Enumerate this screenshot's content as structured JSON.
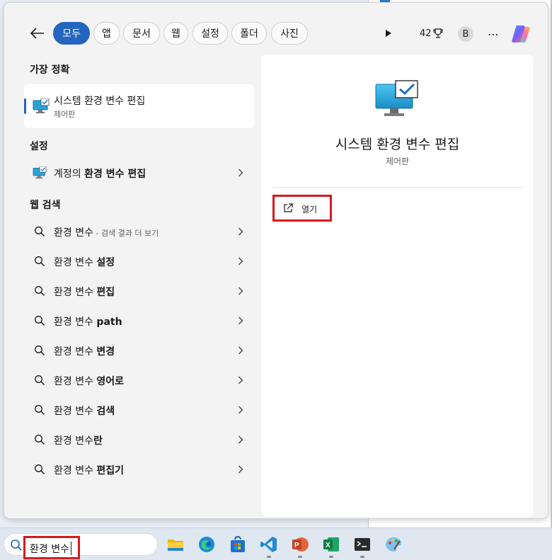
{
  "filters": {
    "back_label": "",
    "chips": [
      {
        "label": "모두",
        "active": true
      },
      {
        "label": "앱",
        "active": false
      },
      {
        "label": "문서",
        "active": false
      },
      {
        "label": "웹",
        "active": false
      },
      {
        "label": "설정",
        "active": false
      },
      {
        "label": "폴더",
        "active": false
      },
      {
        "label": "사진",
        "active": false
      }
    ],
    "points": "42",
    "avatar_letter": "B"
  },
  "best_match": {
    "heading": "가장 정확",
    "title": "시스템 환경 변수 편집",
    "subtitle": "제어판"
  },
  "settings": {
    "heading": "설정",
    "item_prefix": "계정의 ",
    "item_bold": "환경 변수 편집"
  },
  "web": {
    "heading": "웹 검색",
    "items": [
      {
        "plain": "환경 변수",
        "bold": "",
        "sub": " - 검색 결과 더 보기"
      },
      {
        "plain": "환경 변수 ",
        "bold": "설정",
        "sub": ""
      },
      {
        "plain": "환경 변수 ",
        "bold": "편집",
        "sub": ""
      },
      {
        "plain": "환경 변수 ",
        "bold": "path",
        "sub": ""
      },
      {
        "plain": "환경 변수 ",
        "bold": "변경",
        "sub": ""
      },
      {
        "plain": "환경 변수 ",
        "bold": "영어로",
        "sub": ""
      },
      {
        "plain": "환경 변수 ",
        "bold": "검색",
        "sub": ""
      },
      {
        "plain": "환경 변수",
        "bold": "란",
        "sub": ""
      },
      {
        "plain": "환경 변수 ",
        "bold": "편집기",
        "sub": ""
      }
    ]
  },
  "detail": {
    "title": "시스템 환경 변수 편집",
    "subtitle": "제어판",
    "open_label": "열기"
  },
  "taskbar": {
    "search_value": "환경 변수",
    "apps": [
      "file-explorer-icon",
      "edge-icon",
      "store-icon",
      "vscode-icon",
      "powerpoint-icon",
      "excel-icon",
      "terminal-icon",
      "paint-icon"
    ]
  },
  "colors": {
    "accent": "#2465c0",
    "highlight_red": "#d7191f"
  }
}
